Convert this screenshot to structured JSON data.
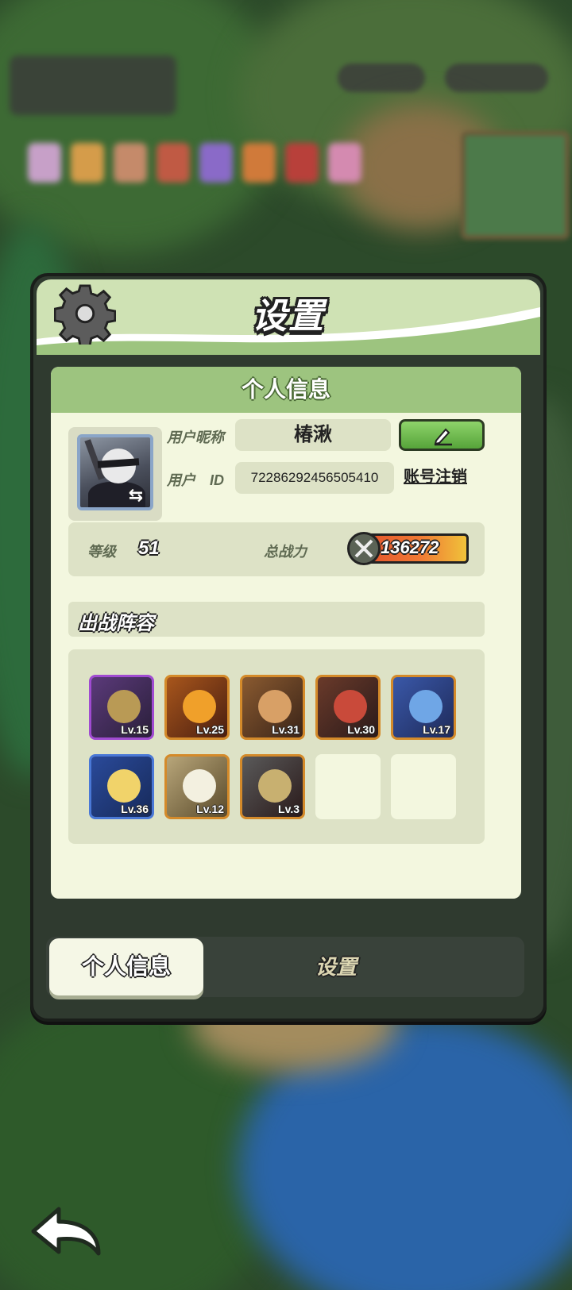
{
  "panel": {
    "title": "设置"
  },
  "card": {
    "header": "个人信息"
  },
  "profile": {
    "nickname_label": "用户昵称",
    "nickname": "椿湫",
    "id_label": "用户　ID",
    "user_id": "72286292456505410",
    "delete_account": "账号注销"
  },
  "stats": {
    "level_label": "等级",
    "level": "51",
    "power_label": "总战力",
    "power": "136272"
  },
  "lineup": {
    "title": "出战阵容",
    "heroes": [
      {
        "level": "Lv.15",
        "rarity": "purple"
      },
      {
        "level": "Lv.25",
        "rarity": "orange"
      },
      {
        "level": "Lv.31",
        "rarity": "orange"
      },
      {
        "level": "Lv.30",
        "rarity": "orange"
      },
      {
        "level": "Lv.17",
        "rarity": "orange"
      },
      {
        "level": "Lv.36",
        "rarity": "blue"
      },
      {
        "level": "Lv.12",
        "rarity": "orange"
      },
      {
        "level": "Lv.3",
        "rarity": "orange"
      }
    ],
    "empty_slots": 2
  },
  "tabs": {
    "profile": "个人信息",
    "settings": "设置"
  },
  "colors": {
    "header_green": "#cfe2b4",
    "card_bg": "#f3f7df",
    "button_green": "#6cc04a"
  }
}
